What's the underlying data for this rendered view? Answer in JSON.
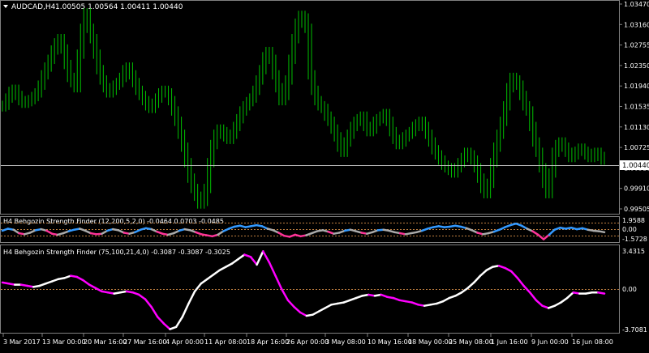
{
  "main": {
    "symbol_label": "AUDCAD,H4",
    "ohlc": "1.00505 1.00564 1.00411 1.00440",
    "price_ticks": [
      "1.03470",
      "1.03160",
      "1.02755",
      "1.02350",
      "1.01940",
      "1.01535",
      "1.01130",
      "1.00725",
      "1.00310",
      "0.99910",
      "0.99505"
    ],
    "current_price": "1.00440"
  },
  "ind1": {
    "title": "H4 Behgozin Strength Finder (12,200,5,2,0) -0.0464 0.0703 -0.0485",
    "ticks": [
      "1.9588",
      "0.00",
      "-1.5728"
    ]
  },
  "ind2": {
    "title": "H4 Behgozin Strength Finder (75,100,21,4,0) -0.3087 -0.3087 -0.3025",
    "ticks": [
      "3.4315",
      "0.00",
      "-3.7081"
    ]
  },
  "time_axis": [
    "3 Mar 2017",
    "13 Mar 00:00",
    "20 Mar 16:00",
    "27 Mar 16:00",
    "4 Apr 00:00",
    "11 Apr 08:00",
    "18 Apr 16:00",
    "26 Apr 00:00",
    "3 May 08:00",
    "10 May 16:00",
    "18 May 00:00",
    "25 May 08:00",
    "1 Jun 16:00",
    "9 Jun 00:00",
    "16 Jun 08:00"
  ],
  "colors": {
    "candle": "#00c000",
    "osc_up": "#ffffff",
    "osc_down": "#ff00ff",
    "ind1_up": "#3399ff",
    "ind1_down": "#ff3399",
    "ind1_neutral": "#aaaaaa",
    "zero_line": "#c08040",
    "current_line": "#c0c0c0"
  },
  "chart_data": [
    {
      "type": "bar",
      "title": "AUDCAD,H4",
      "description_unused": "",
      "x": [
        0,
        4,
        8,
        12,
        16,
        20,
        24,
        28,
        32,
        36,
        40,
        44,
        48,
        52,
        56,
        60,
        64,
        68,
        72,
        76,
        80,
        84,
        88,
        92,
        96,
        100,
        104,
        108,
        112,
        116,
        120,
        124,
        128,
        132,
        136,
        140,
        144,
        148,
        152,
        156,
        160,
        164,
        168,
        172,
        176,
        180,
        184,
        188,
        192,
        196,
        200,
        204,
        208,
        212,
        216,
        220,
        224,
        228,
        232,
        236,
        240,
        244,
        248,
        252,
        256,
        260,
        264,
        268,
        272,
        276,
        280,
        284,
        288,
        292,
        296,
        300,
        304,
        308,
        312,
        316,
        320,
        324,
        328,
        332,
        336,
        340,
        344,
        348,
        352,
        356,
        360,
        364,
        368,
        372,
        376,
        380,
        384,
        388,
        392,
        396,
        400,
        404,
        408,
        412,
        416,
        420,
        424,
        428,
        432,
        436,
        440,
        444,
        448,
        452,
        456,
        460,
        464,
        468,
        472,
        476,
        480,
        484,
        488,
        492,
        496,
        500,
        504,
        508,
        512,
        516,
        520,
        524,
        528,
        532,
        536,
        540,
        544,
        548,
        552,
        556,
        560,
        564,
        568,
        572,
        576,
        580,
        584,
        588,
        592,
        596,
        600,
        604,
        608,
        612,
        616,
        620,
        624,
        628,
        632,
        636,
        640,
        644,
        648,
        652,
        656,
        660,
        664,
        668,
        672,
        676,
        680,
        684,
        688,
        692,
        696,
        700,
        704,
        708,
        712,
        716,
        720,
        724,
        728,
        732,
        736,
        740
      ],
      "values": [
        1.0148,
        1.0151,
        1.0165,
        1.0178,
        1.0182,
        1.017,
        1.016,
        1.0155,
        1.0158,
        1.0162,
        1.0168,
        1.0175,
        1.019,
        1.021,
        1.0225,
        1.024,
        1.0258,
        1.0272,
        1.028,
        1.026,
        1.023,
        1.0205,
        1.0195,
        1.0185,
        1.025,
        1.03,
        1.033,
        1.03,
        1.028,
        1.025,
        1.022,
        1.02,
        1.0185,
        1.0175,
        1.018,
        1.019,
        1.0195,
        1.0205,
        1.022,
        1.0225,
        1.021,
        1.0195,
        1.018,
        1.017,
        1.016,
        1.015,
        1.0145,
        1.0155,
        1.0165,
        1.0175,
        1.018,
        1.0175,
        1.016,
        1.014,
        1.012,
        1.0095,
        1.007,
        1.004,
        1.001,
        0.999,
        0.9975,
        0.996,
        0.9965,
        0.999,
        1.004,
        1.0075,
        1.0095,
        1.0105,
        1.01,
        1.009,
        1.0085,
        1.0095,
        1.011,
        1.0125,
        1.014,
        1.015,
        1.0158,
        1.0165,
        1.018,
        1.02,
        1.022,
        1.0245,
        1.0255,
        1.024,
        1.021,
        1.0185,
        1.016,
        1.017,
        1.02,
        1.024,
        1.028,
        1.031,
        1.0325,
        1.032,
        1.03,
        1.021,
        1.018,
        1.016,
        1.015,
        1.0145,
        1.013,
        1.012,
        1.0105,
        1.009,
        1.007,
        1.006,
        1.008,
        1.0095,
        1.011,
        1.012,
        1.0125,
        1.013,
        1.011,
        1.01,
        1.0105,
        1.012,
        1.0125,
        1.013,
        1.0135,
        1.012,
        1.01,
        1.0085,
        1.0075,
        1.008,
        1.009,
        1.0095,
        1.01,
        1.011,
        1.0115,
        1.012,
        1.011,
        1.0095,
        1.008,
        1.0065,
        1.0055,
        1.0045,
        1.0035,
        1.003,
        1.0025,
        1.002,
        1.003,
        1.004,
        1.005,
        1.006,
        1.0055,
        1.0045,
        1.003,
        1.001,
        0.999,
        0.998,
        1.0,
        1.004,
        1.007,
        1.0095,
        1.012,
        1.015,
        1.0185,
        1.0205,
        1.02,
        1.019,
        1.017,
        1.015,
        1.014,
        1.011,
        1.008,
        1.006,
        1.003,
        1.0,
        0.998,
        1.002,
        1.006,
        1.0075,
        1.008,
        1.007,
        1.006,
        1.005,
        1.0055,
        1.0062,
        1.0068,
        1.0062,
        1.0055,
        1.005,
        1.0058,
        1.006,
        1.0052,
        1.0045
      ],
      "ylim": [
        0.99505,
        1.0347
      ]
    },
    {
      "type": "line",
      "title": "H4 Behgozin Strength Finder (12,200,5,2,0)",
      "ylim": [
        -1.5728,
        1.9588
      ],
      "values": [
        0.2,
        0.6,
        0.4,
        -0.3,
        -0.5,
        -0.2,
        0.3,
        0.5,
        0.2,
        -0.4,
        -0.6,
        -0.3,
        0.1,
        0.4,
        0.6,
        0.2,
        -0.3,
        -0.5,
        -0.4,
        0.2,
        0.5,
        0.3,
        -0.2,
        -0.4,
        -0.1,
        0.4,
        0.7,
        0.5,
        0.0,
        -0.4,
        -0.6,
        -0.3,
        0.2,
        0.5,
        0.3,
        -0.1,
        -0.5,
        -0.7,
        -0.9,
        -0.6,
        0.1,
        0.6,
        1.0,
        1.2,
        0.9,
        1.1,
        1.3,
        1.1,
        0.6,
        0.3,
        -0.2,
        -0.8,
        -1.0,
        -0.6,
        -0.9,
        -0.7,
        -0.3,
        0.1,
        0.3,
        0.0,
        -0.4,
        -0.2,
        0.2,
        0.4,
        0.1,
        -0.2,
        -0.4,
        -0.1,
        0.3,
        0.4,
        0.2,
        -0.1,
        -0.3,
        -0.5,
        -0.3,
        -0.1,
        0.2,
        0.6,
        0.9,
        1.1,
        0.9,
        1.0,
        1.2,
        1.0,
        0.7,
        0.3,
        -0.2,
        -0.5,
        -0.3,
        0.0,
        0.4,
        0.9,
        1.3,
        1.6,
        1.2,
        0.6,
        0.1,
        -0.6,
        -1.5,
        -0.6,
        0.4,
        0.8,
        0.6,
        0.8,
        0.5,
        0.7,
        0.4,
        0.2,
        0.1,
        -0.1
      ]
    },
    {
      "type": "line",
      "title": "H4 Behgozin Strength Finder (75,100,21,4,0)",
      "ylim": [
        -3.7081,
        3.4315
      ],
      "values": [
        0.6,
        0.5,
        0.4,
        0.4,
        0.3,
        0.2,
        0.3,
        0.5,
        0.7,
        0.9,
        1.0,
        1.2,
        1.1,
        0.8,
        0.4,
        0.1,
        -0.2,
        -0.3,
        -0.4,
        -0.3,
        -0.2,
        -0.3,
        -0.5,
        -0.9,
        -1.6,
        -2.5,
        -3.1,
        -3.6,
        -3.4,
        -2.5,
        -1.3,
        -0.2,
        0.5,
        0.9,
        1.3,
        1.7,
        2.0,
        2.3,
        2.7,
        3.1,
        2.9,
        2.2,
        3.4,
        2.4,
        1.2,
        0.0,
        -1.0,
        -1.6,
        -2.1,
        -2.4,
        -2.3,
        -2.0,
        -1.7,
        -1.4,
        -1.3,
        -1.2,
        -1.0,
        -0.8,
        -0.6,
        -0.5,
        -0.6,
        -0.5,
        -0.7,
        -0.8,
        -1.0,
        -1.1,
        -1.2,
        -1.4,
        -1.5,
        -1.4,
        -1.3,
        -1.1,
        -0.8,
        -0.6,
        -0.3,
        0.1,
        0.6,
        1.2,
        1.7,
        2.0,
        2.1,
        1.9,
        1.6,
        1.0,
        0.3,
        -0.3,
        -1.0,
        -1.5,
        -1.7,
        -1.5,
        -1.2,
        -0.8,
        -0.3,
        -0.4,
        -0.4,
        -0.3,
        -0.3,
        -0.4
      ]
    }
  ]
}
